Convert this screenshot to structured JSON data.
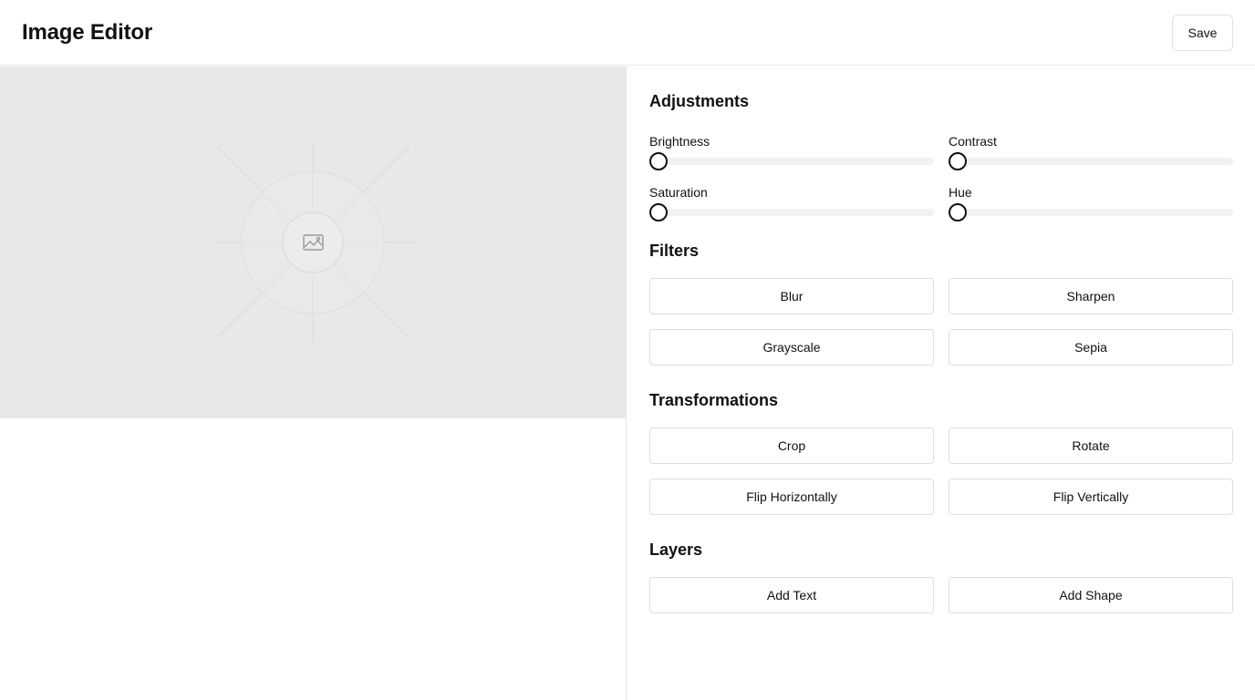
{
  "header": {
    "title": "Image Editor",
    "save_label": "Save"
  },
  "canvas": {
    "placeholder_icon": "image-icon",
    "background_color": "#e8e8e8"
  },
  "adjustments": {
    "title": "Adjustments",
    "sliders": [
      {
        "label": "Brightness",
        "value": 0
      },
      {
        "label": "Contrast",
        "value": 0
      },
      {
        "label": "Saturation",
        "value": 0
      },
      {
        "label": "Hue",
        "value": 0
      }
    ]
  },
  "filters": {
    "title": "Filters",
    "buttons": [
      "Blur",
      "Sharpen",
      "Grayscale",
      "Sepia"
    ]
  },
  "transformations": {
    "title": "Transformations",
    "buttons": [
      "Crop",
      "Rotate",
      "Flip Horizontally",
      "Flip Vertically"
    ]
  },
  "layers": {
    "title": "Layers",
    "buttons": [
      "Add Text",
      "Add Shape"
    ]
  }
}
